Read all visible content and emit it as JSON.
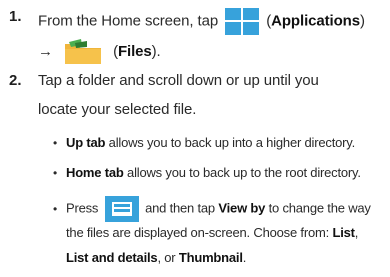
{
  "step1": {
    "number": "1.",
    "text_a": "From the Home screen, tap",
    "apps_open": "(",
    "apps_label": "Applications",
    "apps_close": ")",
    "arrow": "→",
    "files_open": "(",
    "files_label": "Files",
    "files_close": ")."
  },
  "step2": {
    "number": "2.",
    "line1": "Tap a folder and scroll down or up until you",
    "line2": "locate your selected file."
  },
  "bullets": [
    {
      "symbol": "•",
      "bold": "Up tab",
      "text": " allows you to back up into a higher directory."
    },
    {
      "symbol": "•",
      "bold": "Home tab",
      "text": " allows you to back up to the root directory."
    }
  ],
  "press_bullet": {
    "symbol": "•",
    "press": "Press",
    "then_tap": "and then tap",
    "view_by": "View by",
    "line1_tail": "to change the way",
    "line2_a": "the files are displayed on-screen. Choose from:",
    "opt_list": "List",
    "comma": ",",
    "opt_list_details": "List and details",
    "or": ", or",
    "opt_thumbnail": "Thumbnail",
    "period": "."
  },
  "colors": {
    "icon_blue": "#37a2db",
    "folder_yellow": "#f0b53a",
    "folder_green": "#4caf50"
  },
  "icons": [
    "applications-grid-icon",
    "files-folder-icon",
    "menu-icon"
  ]
}
